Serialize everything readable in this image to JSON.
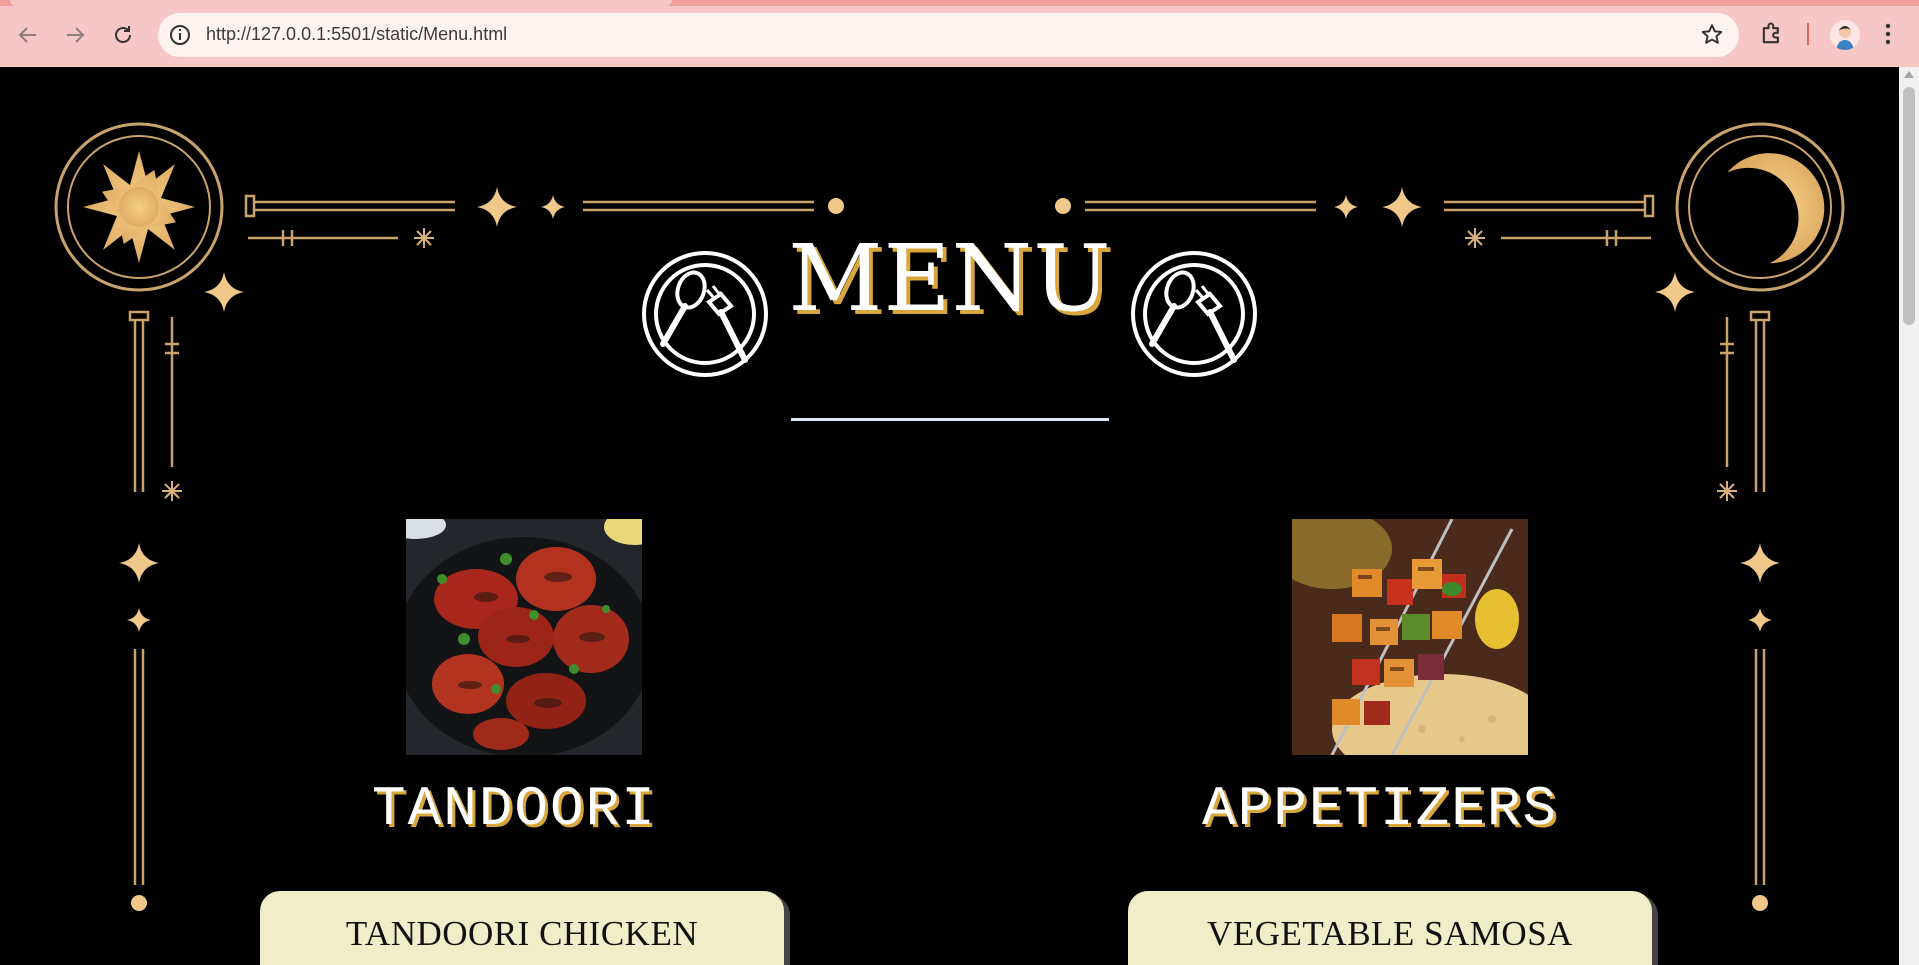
{
  "browser": {
    "url": "http://127.0.0.1:5501/static/Menu.html",
    "icons": [
      "back-arrow-icon",
      "forward-arrow-icon",
      "reload-icon",
      "site-info-icon",
      "bookmark-star-icon",
      "extensions-puzzle-icon",
      "profile-avatar-icon",
      "more-menu-icon"
    ]
  },
  "page": {
    "title": "MENU",
    "categories": [
      {
        "name": "TANDOORI",
        "first_item": "TANDOORI CHICKEN",
        "image": "tandoori-chicken-photo"
      },
      {
        "name": "APPETIZERS",
        "first_item": "VEGETABLE SAMOSA",
        "image": "paneer-tikka-photo"
      }
    ]
  },
  "colors": {
    "background": "#000000",
    "gold": "#d8a63a",
    "ornament": "#c9a36b",
    "card": "#efeec9",
    "underline": "#d9e9f3",
    "chrome": "#f6c7c4"
  }
}
